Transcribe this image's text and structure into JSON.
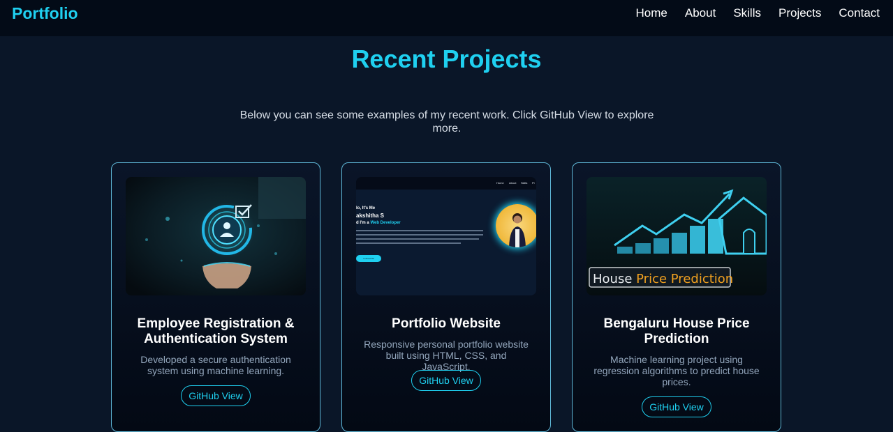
{
  "nav": {
    "logo": "Portfolio",
    "links": [
      "Home",
      "About",
      "Skills",
      "Projects",
      "Contact"
    ]
  },
  "projects_section": {
    "title": "Recent Projects",
    "description": "Below you can see some examples of my recent work. Click GitHub View to explore more."
  },
  "cards": [
    {
      "title": "Employee Registration & Authentication System",
      "description": "Developed a secure authentication system using machine learning.",
      "button": "GitHub View",
      "image_icon": "user-authentication-image"
    },
    {
      "title": "Portfolio Website",
      "description": "Responsive personal portfolio website built using HTML, CSS, and JavaScript.",
      "button": "GitHub View",
      "image_icon": "portfolio-screenshot-image",
      "preview": {
        "nav_items": [
          "Home",
          "About",
          "Skills",
          "Pr"
        ],
        "hello": "lo, It's Me",
        "name": "akshitha S",
        "role_prefix": "d I'm a ",
        "role_highlight": "Web Developer",
        "button": "re About Me"
      }
    },
    {
      "title": "Bengaluru House Price Prediction",
      "description": "Machine learning project using regression algorithms to predict house prices.",
      "button": "GitHub View",
      "image_icon": "house-price-chart-image",
      "image_label_1": "House ",
      "image_label_2": "Price Prediction"
    }
  ],
  "colors": {
    "accent": "#1fd0f0",
    "background": "#0a1628",
    "navbar": "#030b17",
    "card_border": "#5fb8d8",
    "muted_text": "#93a6bc",
    "orange_label": "#f0a020"
  }
}
